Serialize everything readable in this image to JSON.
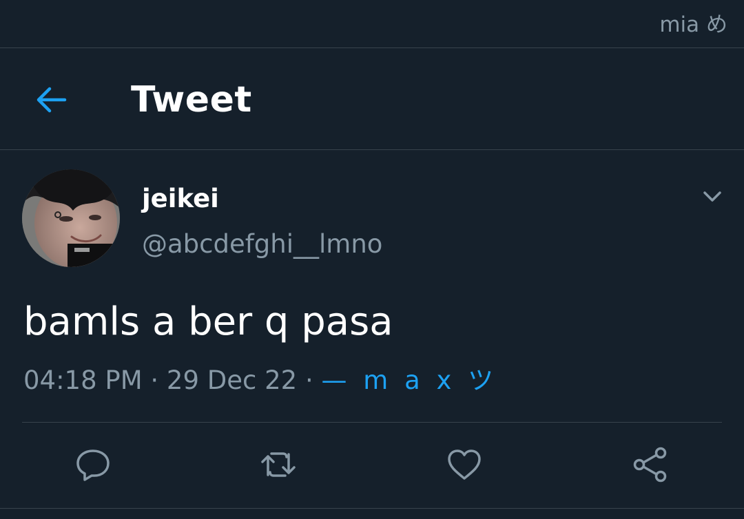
{
  "status_bar": {
    "user_label": "mia め"
  },
  "header": {
    "title": "Tweet",
    "back_icon": "arrow-left-icon"
  },
  "tweet": {
    "display_name": "jeikei",
    "handle": "@abcdefghi__lmno",
    "text": "bamls a ber q pasa",
    "time": "04:18 PM",
    "date": "29 Dec 22",
    "separator": "·",
    "source": "— m a x ツ",
    "menu_icon": "chevron-down-icon"
  },
  "actions": [
    {
      "name": "reply",
      "icon": "comment-icon"
    },
    {
      "name": "retweet",
      "icon": "retweet-icon"
    },
    {
      "name": "like",
      "icon": "heart-icon"
    },
    {
      "name": "share",
      "icon": "share-icon"
    }
  ],
  "colors": {
    "background": "#15202b",
    "accent": "#1da1f2",
    "secondary_text": "#8899a6",
    "divider": "#38444d"
  }
}
